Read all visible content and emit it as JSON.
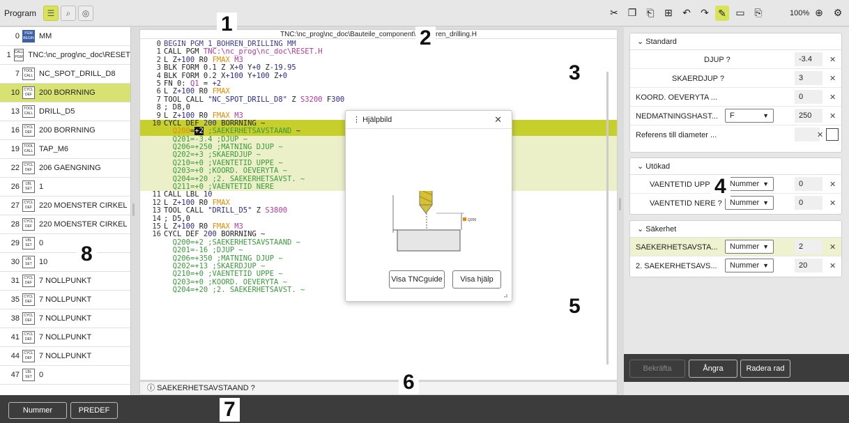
{
  "toolbar": {
    "program_label": "Program",
    "zoom": "100%"
  },
  "callouts": {
    "n1": "1",
    "n2": "2",
    "n3": "3",
    "n4": "4",
    "n5": "5",
    "n6": "6",
    "n7": "7",
    "n8": "8"
  },
  "left_list": [
    {
      "num": "0",
      "t1": "PGM",
      "t2": "BEGIN",
      "text": "MM",
      "pgm": true
    },
    {
      "num": "1",
      "t1": "CALL",
      "t2": "PGM",
      "text": "TNC:\\nc_prog\\nc_doc\\RESET"
    },
    {
      "num": "7",
      "t1": "TOOL",
      "t2": "CALL",
      "text": "NC_SPOT_DRILL_D8"
    },
    {
      "num": "10",
      "t1": "CYCL",
      "t2": "DEF",
      "text": "200 BORRNING",
      "sel": true
    },
    {
      "num": "13",
      "t1": "TOOL",
      "t2": "CALL",
      "text": "DRILL_D5"
    },
    {
      "num": "16",
      "t1": "CYCL",
      "t2": "DEF",
      "text": "200 BORRNING"
    },
    {
      "num": "19",
      "t1": "TOOL",
      "t2": "CALL",
      "text": "TAP_M6"
    },
    {
      "num": "22",
      "t1": "CYCL",
      "t2": "DEF",
      "text": "206 GAENGNING"
    },
    {
      "num": "26",
      "t1": "LBL",
      "t2": "SET",
      "text": "1"
    },
    {
      "num": "27",
      "t1": "CYCL",
      "t2": "DEF",
      "text": "220 MOENSTER CIRKEL"
    },
    {
      "num": "28",
      "t1": "CYCL",
      "t2": "DEF",
      "text": "220 MOENSTER CIRKEL"
    },
    {
      "num": "29",
      "t1": "LBL",
      "t2": "SET",
      "text": "0"
    },
    {
      "num": "30",
      "t1": "LBL",
      "t2": "SET",
      "text": "10"
    },
    {
      "num": "31",
      "t1": "CYCL",
      "t2": "DEF",
      "text": "7 NOLLPUNKT"
    },
    {
      "num": "35",
      "t1": "CYCL",
      "t2": "DEF",
      "text": "7 NOLLPUNKT"
    },
    {
      "num": "38",
      "t1": "CYCL",
      "t2": "DEF",
      "text": "7 NOLLPUNKT"
    },
    {
      "num": "41",
      "t1": "CYCL",
      "t2": "DEF",
      "text": "7 NOLLPUNKT"
    },
    {
      "num": "44",
      "t1": "CYCL",
      "t2": "DEF",
      "text": "7 NOLLPUNKT"
    },
    {
      "num": "47",
      "t1": "LBL",
      "t2": "SET",
      "text": "0"
    }
  ],
  "editor": {
    "title": "TNC:\\nc_prog\\nc_doc\\Bauteile_component\\1_Bohren_drilling.H",
    "status": "SAEKERHETSAVSTAAND ?"
  },
  "dialog": {
    "title": "Hjälpbild",
    "btn1": "Visa TNCguide",
    "btn2": "Visa hjälp",
    "q_label": "Q200"
  },
  "right": {
    "standard": "Standard",
    "djup_label": "DJUP ?",
    "djup_val": "-3.4",
    "skaer_label": "SKAERDJUP ?",
    "skaer_val": "3",
    "koord_label": "KOORD. OEVERYTA ...",
    "koord_val": "0",
    "ned_label": "NEDMATNINGSHAST...",
    "ned_sel": "F",
    "ned_val": "250",
    "ref_label": "Referens till diameter ...",
    "utokad": "Utökad",
    "vu_label": "VAENTETID UPPE ?",
    "vu_sel": "Nummer",
    "vu_val": "0",
    "vn_label": "VAENTETID NERE ?",
    "vn_sel": "Nummer",
    "vn_val": "0",
    "sakerhet": "Säkerhet",
    "sa_label": "SAEKERHETSAVSTA...",
    "sa_sel": "Nummer",
    "sa_val": "2",
    "sa2_label": "2. SAEKERHETSAVS...",
    "sa2_sel": "Nummer",
    "sa2_val": "20",
    "bekrafta": "Bekräfta",
    "angra": "Ångra",
    "radera": "Radera rad"
  },
  "footer": {
    "nummer": "Nummer",
    "predef": "PREDEF"
  }
}
